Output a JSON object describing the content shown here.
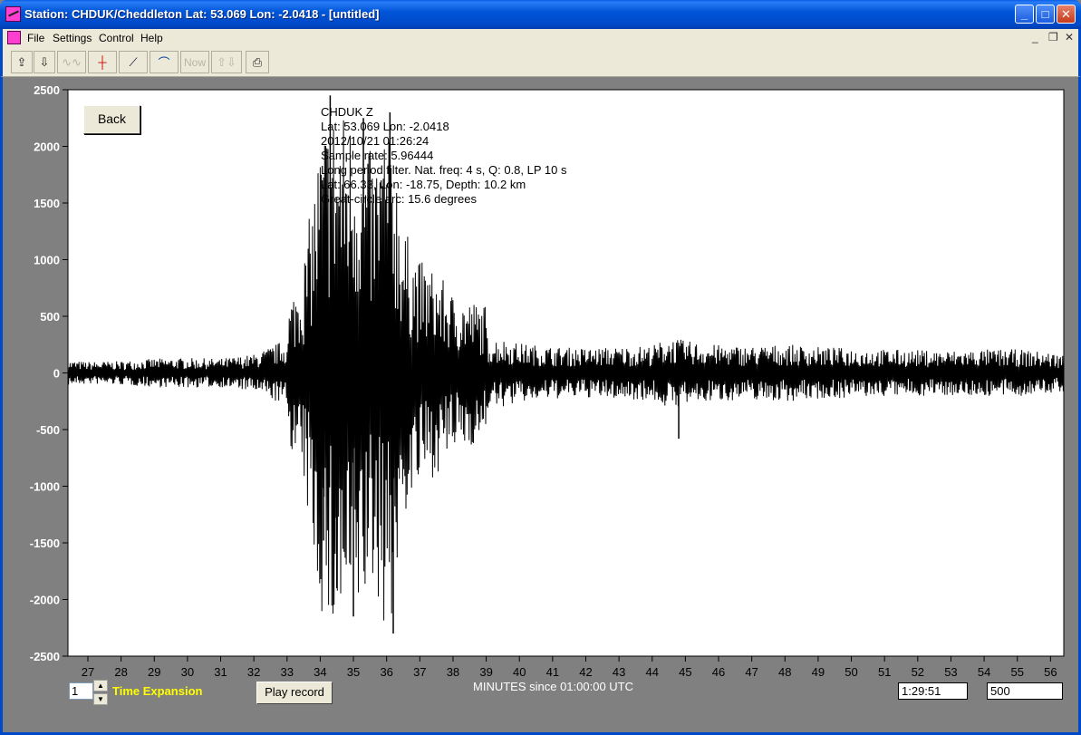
{
  "window": {
    "title": "Station: CHDUK/Cheddleton Lat: 53.069 Lon: -2.0418 - [untitled]",
    "minimize_icon": "minimize-icon",
    "maximize_icon": "maximize-icon",
    "close_icon": "close-icon"
  },
  "menu": {
    "items": [
      "File",
      "Settings",
      "Control",
      "Help"
    ]
  },
  "toolbar": {
    "now_label": "Now",
    "icons": [
      "open-icon",
      "save-icon",
      "waveform-icon",
      "pick-icon",
      "slope-icon",
      "pulse-icon",
      "now-icon",
      "up-down-arrows-icon",
      "print-icon"
    ]
  },
  "plot": {
    "back_label": "Back",
    "info": [
      "CHDUK  Z",
      "Lat: 53.069 Lon: -2.0418",
      "2012/10/21 01:26:24",
      "Sample rate: 5.96444",
      "Long period filter. Nat. freq: 4 s, Q: 0.8, LP 10 s",
      "Lat: 66.33, Lon: -18.75, Depth: 10.2 km",
      "Great-circle arc: 15.6 degrees"
    ]
  },
  "chart_data": {
    "type": "line",
    "title": "",
    "xlabel": "MINUTES since 01:00:00 UTC",
    "ylabel": "",
    "xlim": [
      26.4,
      56.4
    ],
    "ylim": [
      -2500,
      2500
    ],
    "yticks": [
      "2500",
      "2000",
      "1500",
      "1000",
      "500",
      "0",
      "-500",
      "-1000",
      "-1500",
      "-2000",
      "-2500"
    ],
    "ytick_values": [
      2500,
      2000,
      1500,
      1000,
      500,
      0,
      -500,
      -1000,
      -1500,
      -2000,
      -2500
    ],
    "xticks": [
      "27",
      "28",
      "29",
      "30",
      "31",
      "32",
      "33",
      "34",
      "35",
      "36",
      "37",
      "38",
      "39",
      "40",
      "41",
      "42",
      "43",
      "44",
      "45",
      "46",
      "47",
      "48",
      "49",
      "50",
      "51",
      "52",
      "53",
      "54",
      "55",
      "56"
    ],
    "xtick_values": [
      27,
      28,
      29,
      30,
      31,
      32,
      33,
      34,
      35,
      36,
      37,
      38,
      39,
      40,
      41,
      42,
      43,
      44,
      45,
      46,
      47,
      48,
      49,
      50,
      51,
      52,
      53,
      54,
      55,
      56
    ],
    "grid": false,
    "series": [
      {
        "color": "#000000",
        "envelope_x": [
          26.4,
          27,
          28,
          29,
          30,
          31,
          32,
          32.5,
          33,
          33.5,
          34,
          34.3,
          34.6,
          35,
          35.3,
          35.6,
          36,
          36.2,
          36.5,
          37,
          37.5,
          38,
          38.5,
          39,
          39.5,
          40,
          41,
          42,
          43,
          44,
          44.5,
          45,
          46,
          47,
          48,
          49,
          50,
          51,
          52,
          53,
          54,
          55,
          56,
          56.4
        ],
        "envelope_amp": [
          200,
          180,
          190,
          230,
          240,
          230,
          300,
          420,
          560,
          1000,
          2100,
          2400,
          2350,
          2300,
          2100,
          1900,
          2300,
          2200,
          1300,
          1000,
          900,
          700,
          650,
          600,
          550,
          480,
          420,
          400,
          420,
          440,
          580,
          520,
          450,
          430,
          460,
          420,
          400,
          380,
          370,
          360,
          380,
          380,
          330,
          300
        ],
        "peaks": [
          {
            "x": 34.3,
            "y": 2450
          },
          {
            "x": 34.5,
            "y": -1900
          },
          {
            "x": 35.0,
            "y": -2150
          },
          {
            "x": 35.3,
            "y": 2250
          },
          {
            "x": 36.1,
            "y": 2300
          },
          {
            "x": 36.2,
            "y": -2300
          },
          {
            "x": 34.1,
            "y": -1480
          },
          {
            "x": 35.6,
            "y": -1560
          },
          {
            "x": 44.8,
            "y": -580
          }
        ]
      }
    ]
  },
  "bottom": {
    "expansion_value": "1",
    "expansion_label": "Time Expansion",
    "play_label": "Play record",
    "time_field": "1:29:51",
    "scale_field": "500"
  }
}
